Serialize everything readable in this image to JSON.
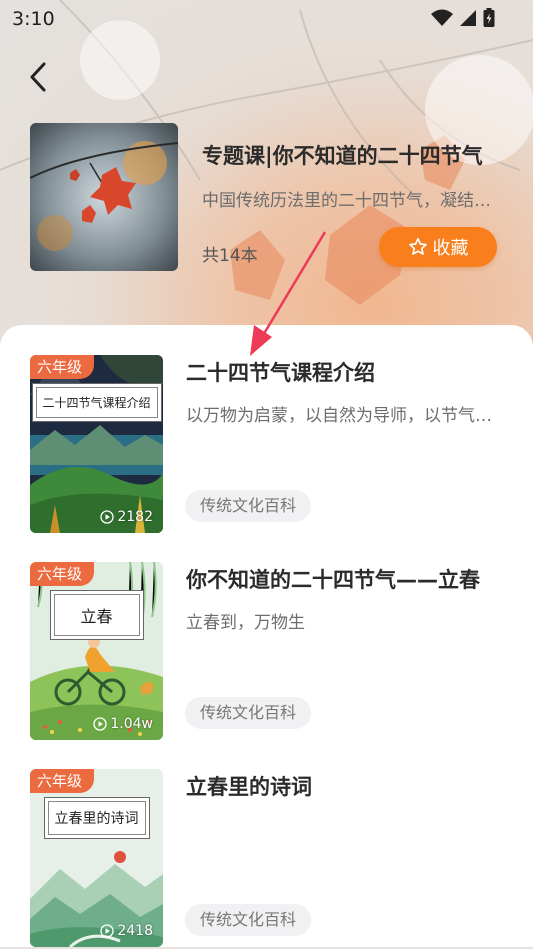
{
  "status_bar": {
    "time": "3:10",
    "icons": [
      "wifi-icon",
      "cellular-signal-icon",
      "battery-icon"
    ]
  },
  "header": {
    "title": "专题课|你不知道的二十四节气",
    "description": "中国传统历法里的二十四节气，凝结着古人的智慧",
    "count": "共14本",
    "favorite_label": "收藏"
  },
  "items": [
    {
      "grade": "六年级",
      "cover_title": "二十四节气课程介绍",
      "plays": "2182",
      "title": "二十四节气课程介绍",
      "description": "以万物为启蒙，以自然为导师，以节气为线索",
      "tag": "传统文化百科"
    },
    {
      "grade": "六年级",
      "cover_title": "立春",
      "plays": "1.04w",
      "title": "你不知道的二十四节气——立春",
      "description": "立春到，万物生",
      "tag": "传统文化百科"
    },
    {
      "grade": "六年级",
      "cover_title": "立春里的诗词",
      "plays": "2418",
      "title": "立春里的诗词",
      "description": "",
      "tag": "传统文化百科"
    }
  ],
  "colors": {
    "accent": "#f87f1c",
    "badge": "#ec6a3f",
    "annotation_arrow": "#ee3a56"
  }
}
